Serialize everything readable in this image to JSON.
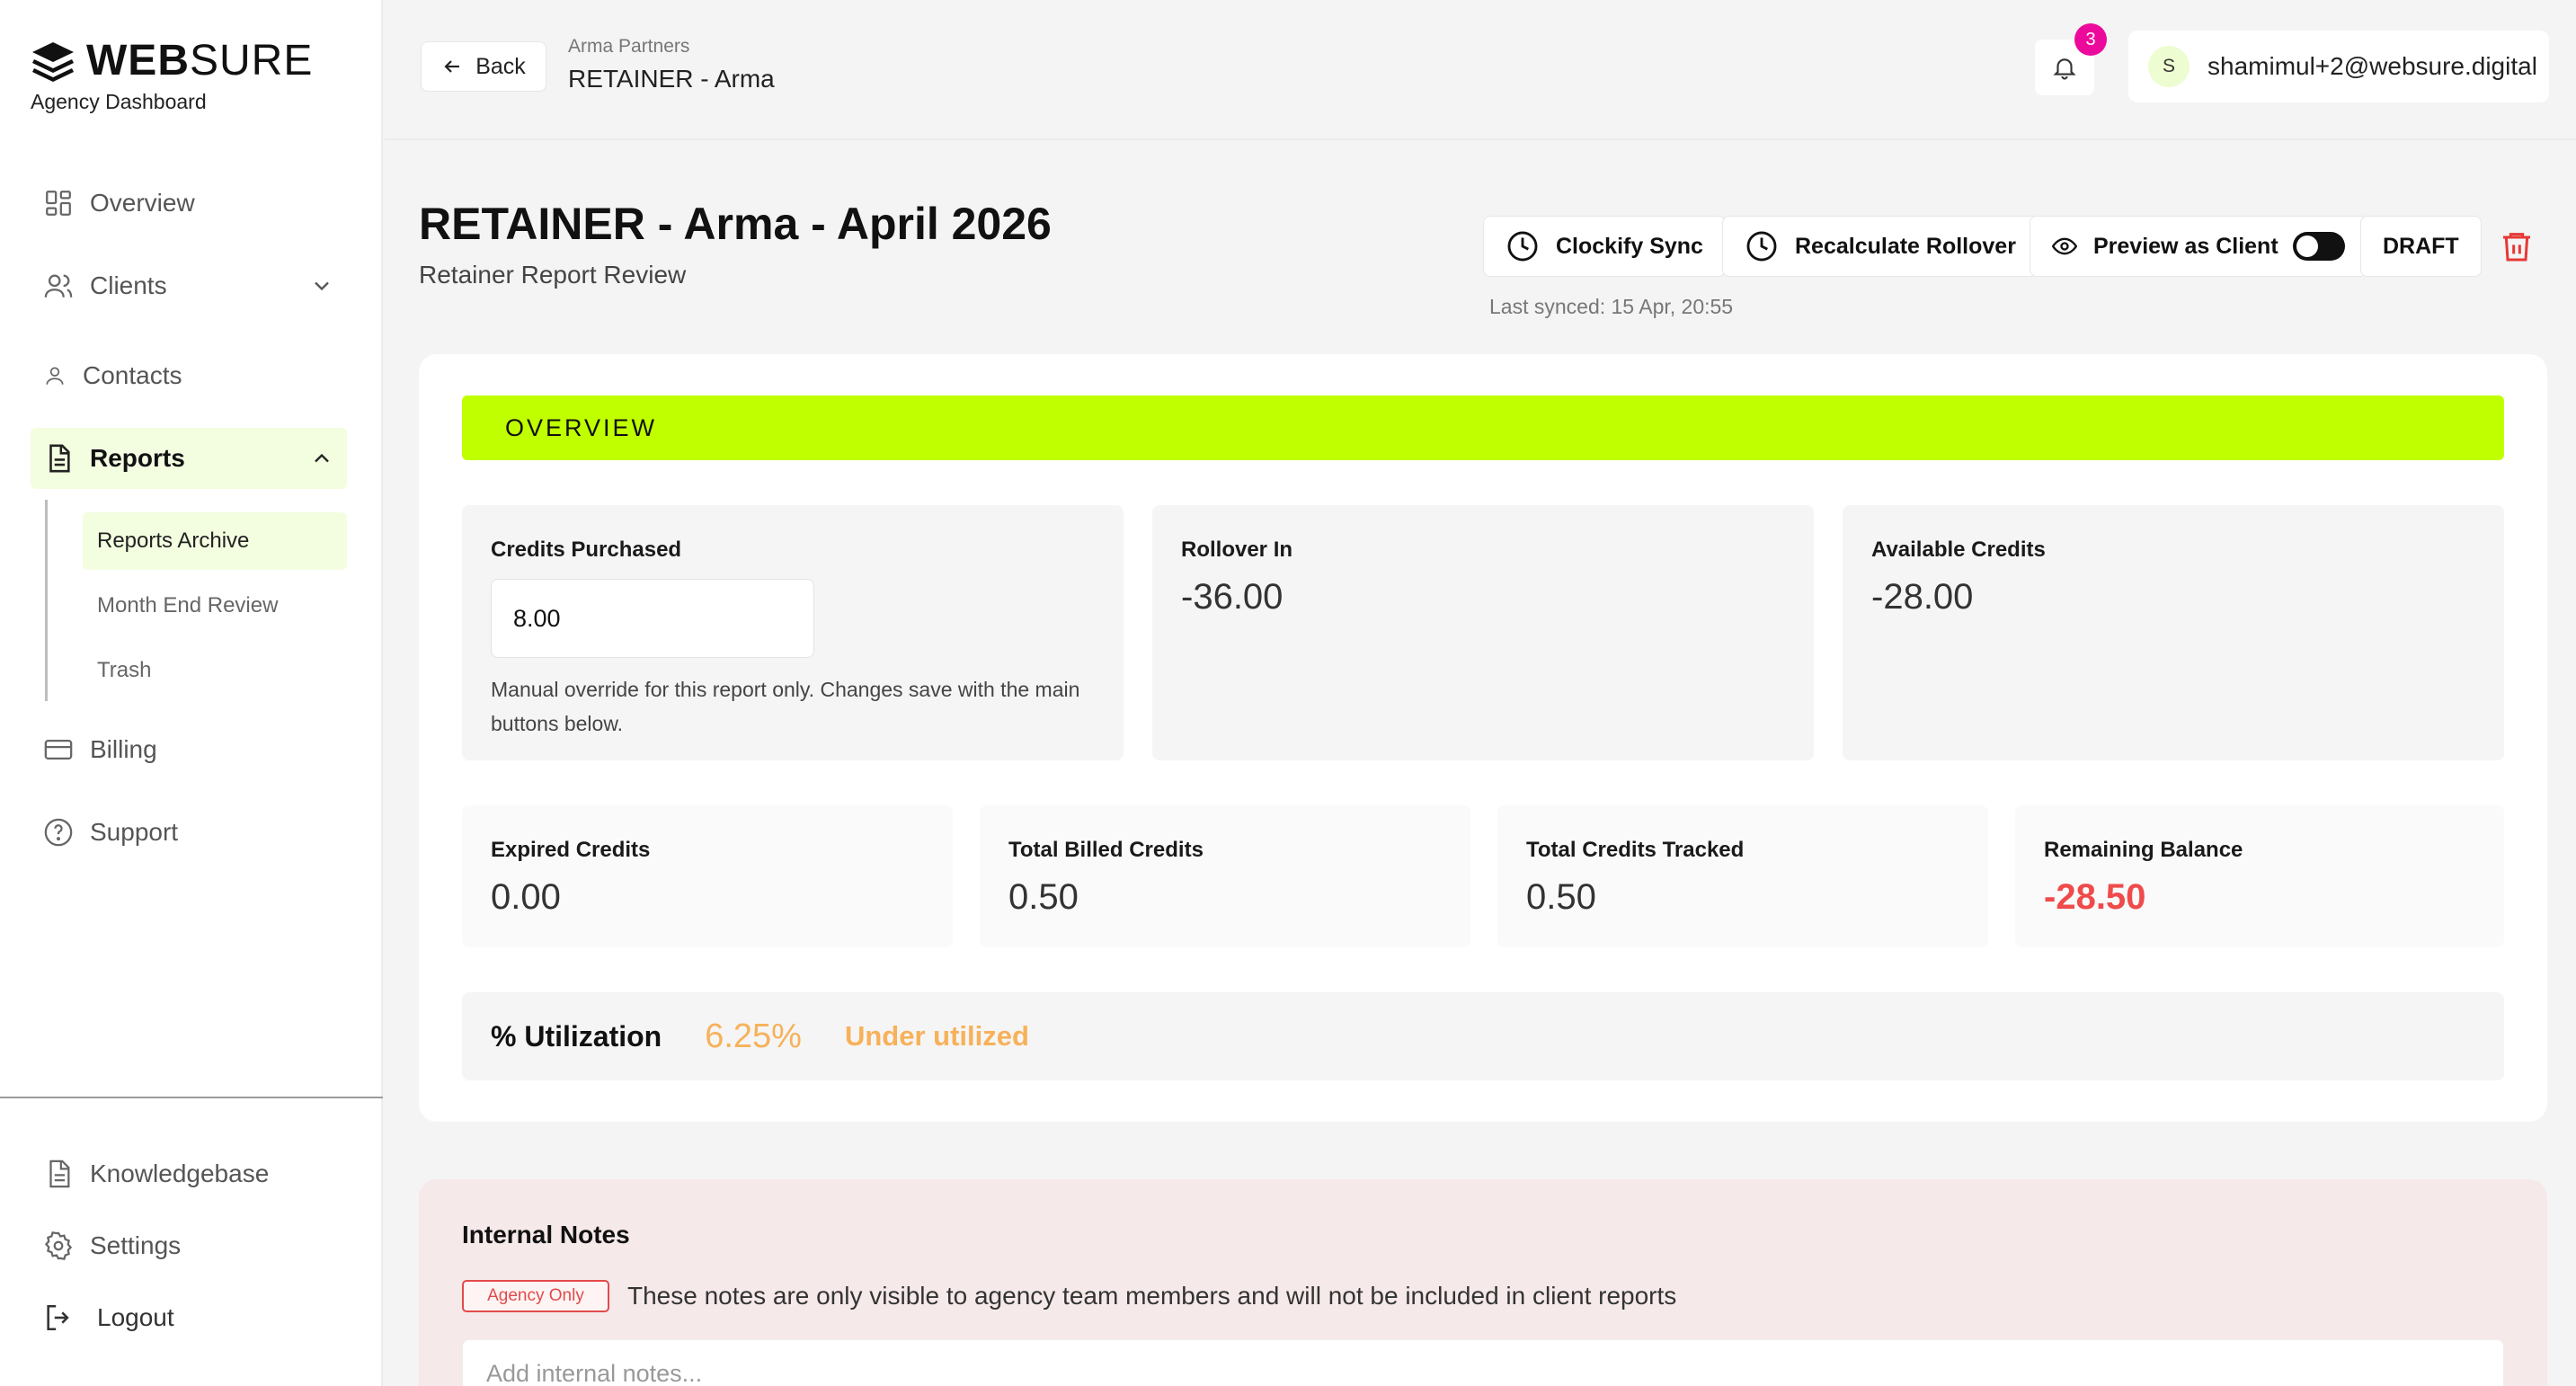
{
  "brand": {
    "name_bold": "WEB",
    "name_light": "SURE",
    "subtitle": "Agency Dashboard"
  },
  "sidebar": {
    "items": [
      {
        "label": "Overview"
      },
      {
        "label": "Clients"
      },
      {
        "label": "Contacts"
      },
      {
        "label": "Reports"
      },
      {
        "label": "Billing"
      },
      {
        "label": "Support"
      }
    ],
    "report_sub_items": [
      {
        "label": "Reports Archive"
      },
      {
        "label": "Month End Review"
      },
      {
        "label": "Trash"
      }
    ],
    "bottom_items": [
      {
        "label": "Knowledgebase"
      },
      {
        "label": "Settings"
      },
      {
        "label": "Logout"
      }
    ]
  },
  "topbar": {
    "back_label": "Back",
    "breadcrumb_parent": "Arma Partners",
    "breadcrumb_current": "RETAINER - Arma",
    "notification_count": "3",
    "user_initial": "S",
    "user_email": "shamimul+2@websure.digital"
  },
  "header": {
    "title": "RETAINER - Arma - April 2026",
    "subtitle": "Retainer Report Review",
    "clockify_label": "Clockify Sync",
    "recalc_label": "Recalculate Rollover",
    "preview_label": "Preview as Client",
    "status_label": "DRAFT",
    "last_synced": "Last synced: 15 Apr, 20:55"
  },
  "overview": {
    "section_label": "OVERVIEW",
    "credits_purchased_label": "Credits Purchased",
    "credits_purchased_value": "8.00",
    "credits_help": "Manual override for this report only. Changes save with the main buttons below.",
    "rollover_label": "Rollover In",
    "rollover_value": "-36.00",
    "available_label": "Available Credits",
    "available_value": "-28.00",
    "expired_label": "Expired Credits",
    "expired_value": "0.00",
    "billed_label": "Total Billed Credits",
    "billed_value": "0.50",
    "tracked_label": "Total Credits Tracked",
    "tracked_value": "0.50",
    "remaining_label": "Remaining Balance",
    "remaining_value": "-28.50",
    "utilization_label": "% Utilization",
    "utilization_value": "6.25%",
    "utilization_status": "Under utilized"
  },
  "notes": {
    "title": "Internal Notes",
    "tag": "Agency Only",
    "description": "These notes are only visible to agency team members and will not be included in client reports",
    "placeholder": "Add internal notes..."
  },
  "colors": {
    "accent": "#c0ff00",
    "active_bg": "#f3fde0",
    "negative": "#ef4b4b",
    "warning": "#f7b15a",
    "badge": "#ec0a9c",
    "notes_bg": "#f6e9ea"
  },
  "icons": [
    "layers-logo-icon",
    "grid-icon",
    "users-icon",
    "chevron-down-icon",
    "user-icon",
    "file-icon",
    "chevron-up-icon",
    "credit-card-icon",
    "help-circle-icon",
    "document-icon",
    "gear-icon",
    "logout-icon",
    "arrow-left-icon",
    "bell-icon",
    "clock-icon",
    "eye-icon",
    "trash-icon"
  ]
}
